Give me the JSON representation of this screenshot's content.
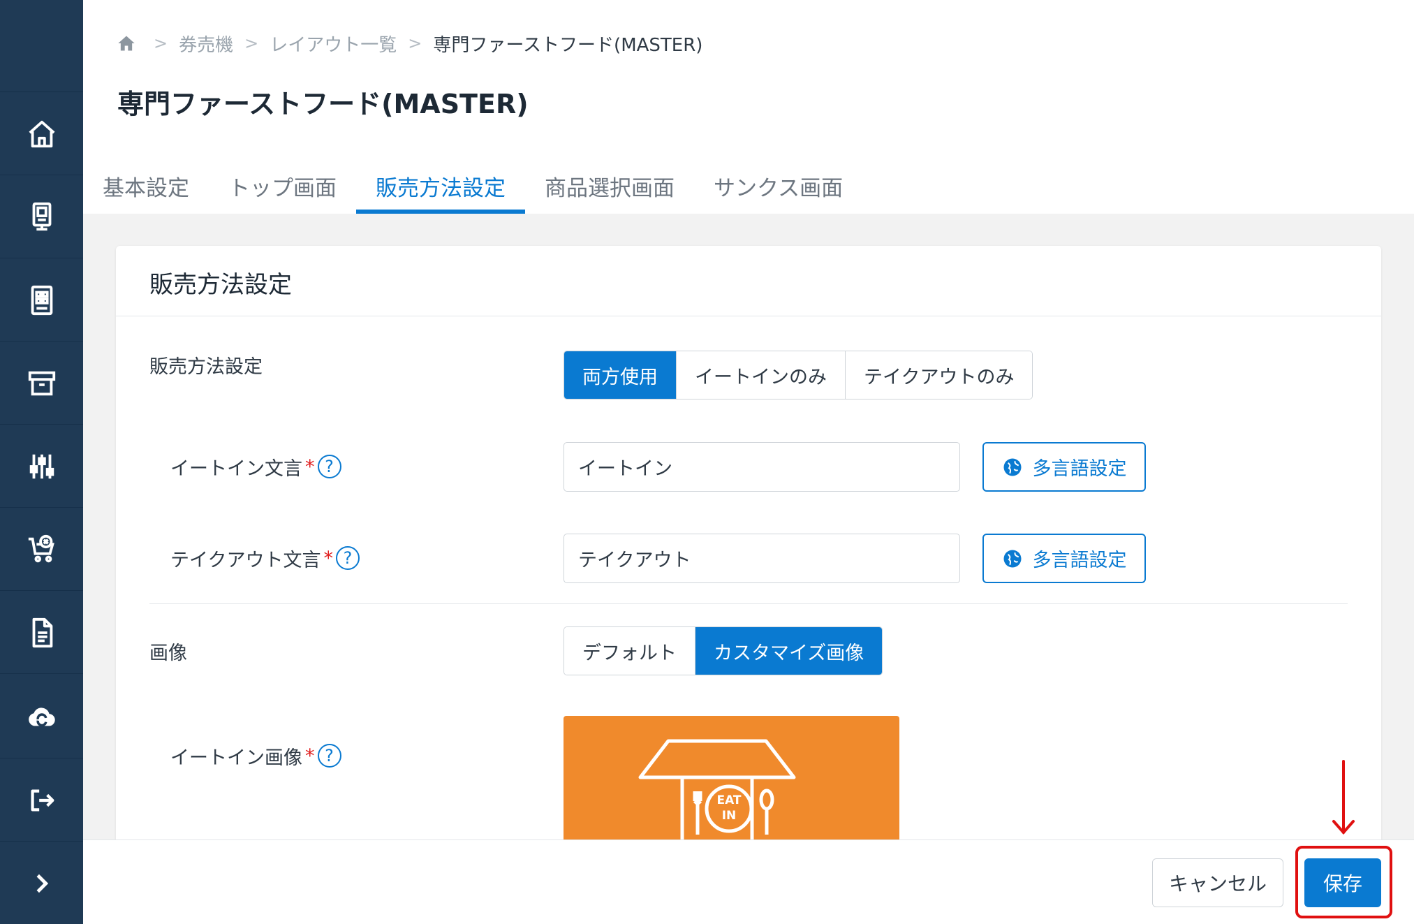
{
  "breadcrumb": {
    "home_icon": "home-icon",
    "items": [
      "券売機",
      "レイアウト一覧",
      "専門ファーストフード(MASTER)"
    ]
  },
  "page_title": "専門ファーストフード(MASTER)",
  "tabs": [
    {
      "label": "基本設定",
      "active": false
    },
    {
      "label": "トップ画面",
      "active": false
    },
    {
      "label": "販売方法設定",
      "active": true
    },
    {
      "label": "商品選択画面",
      "active": false
    },
    {
      "label": "サンクス画面",
      "active": false
    }
  ],
  "sidebar": {
    "items": [
      "home-icon",
      "kiosk-icon",
      "layout-icon",
      "archive-icon",
      "sliders-icon",
      "cart-cancel-icon",
      "document-icon",
      "cloud-sync-icon",
      "logout-icon",
      "chevron-right-icon"
    ]
  },
  "card": {
    "title": "販売方法設定",
    "sales_method": {
      "label": "販売方法設定",
      "options": [
        "両方使用",
        "イートインのみ",
        "テイクアウトのみ"
      ],
      "selected": "両方使用"
    },
    "eat_in_text": {
      "label": "イートイン文言",
      "required": "*",
      "help": "?",
      "value": "イートイン",
      "multilang_label": "多言語設定"
    },
    "takeout_text": {
      "label": "テイクアウト文言",
      "required": "*",
      "help": "?",
      "value": "テイクアウト",
      "multilang_label": "多言語設定"
    },
    "image": {
      "label": "画像",
      "options": [
        "デフォルト",
        "カスタマイズ画像"
      ],
      "selected": "カスタマイズ画像"
    },
    "eat_in_image": {
      "label": "イートイン画像",
      "required": "*",
      "help": "?",
      "badge_line1": "EAT",
      "badge_line2": "IN"
    }
  },
  "footer": {
    "cancel_label": "キャンセル",
    "save_label": "保存"
  },
  "colors": {
    "sidebar": "#1f3a55",
    "accent": "#0a7ad1",
    "image_bg": "#f08a2c",
    "highlight": "#e01010"
  }
}
